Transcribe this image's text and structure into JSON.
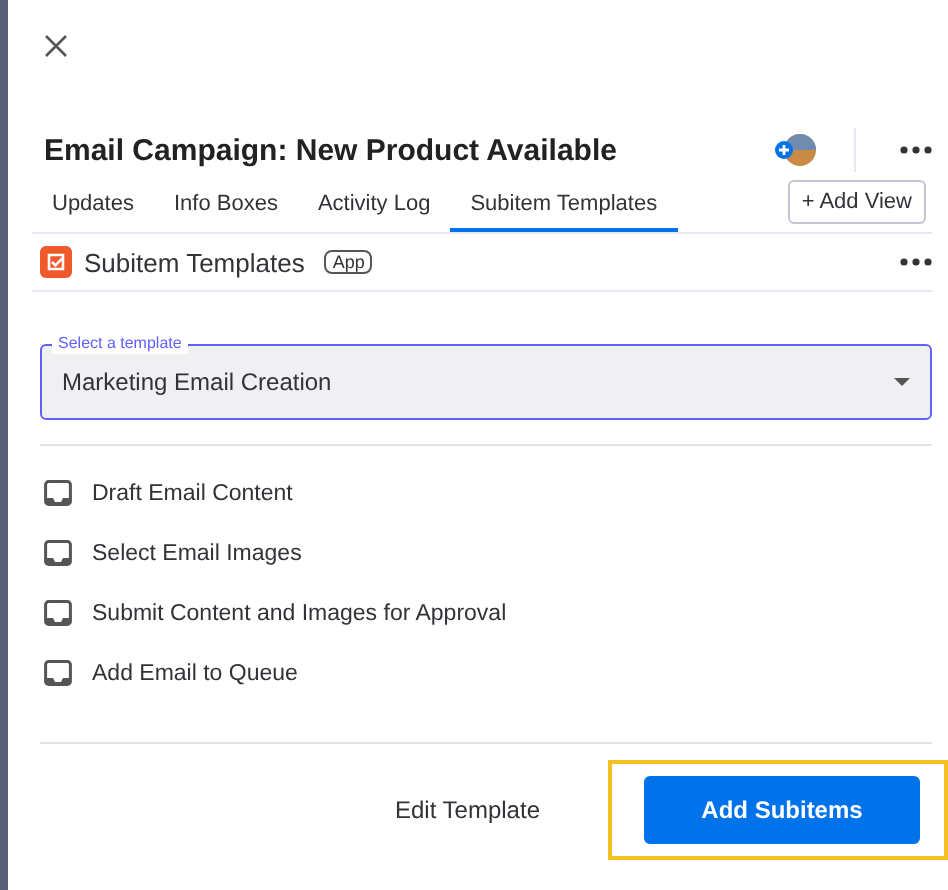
{
  "item": {
    "title": "Email Campaign: New Product Available"
  },
  "tabs": [
    {
      "label": "Updates",
      "selected": false
    },
    {
      "label": "Info Boxes",
      "selected": false
    },
    {
      "label": "Activity Log",
      "selected": false
    },
    {
      "label": "Subitem Templates",
      "selected": true
    }
  ],
  "add_view": "+ Add View",
  "app": {
    "name": "Subitem Templates",
    "badge": "App"
  },
  "template_select": {
    "label": "Select a template",
    "value": "Marketing Email Creation"
  },
  "subitems": [
    {
      "label": "Draft Email Content"
    },
    {
      "label": "Select Email Images"
    },
    {
      "label": "Submit Content and Images for Approval"
    },
    {
      "label": "Add Email to Queue"
    }
  ],
  "actions": [
    {
      "kind": "link",
      "label": "Edit Template",
      "highlighted": false
    },
    {
      "kind": "primary",
      "label": "Add Subitems",
      "highlighted": true
    }
  ]
}
